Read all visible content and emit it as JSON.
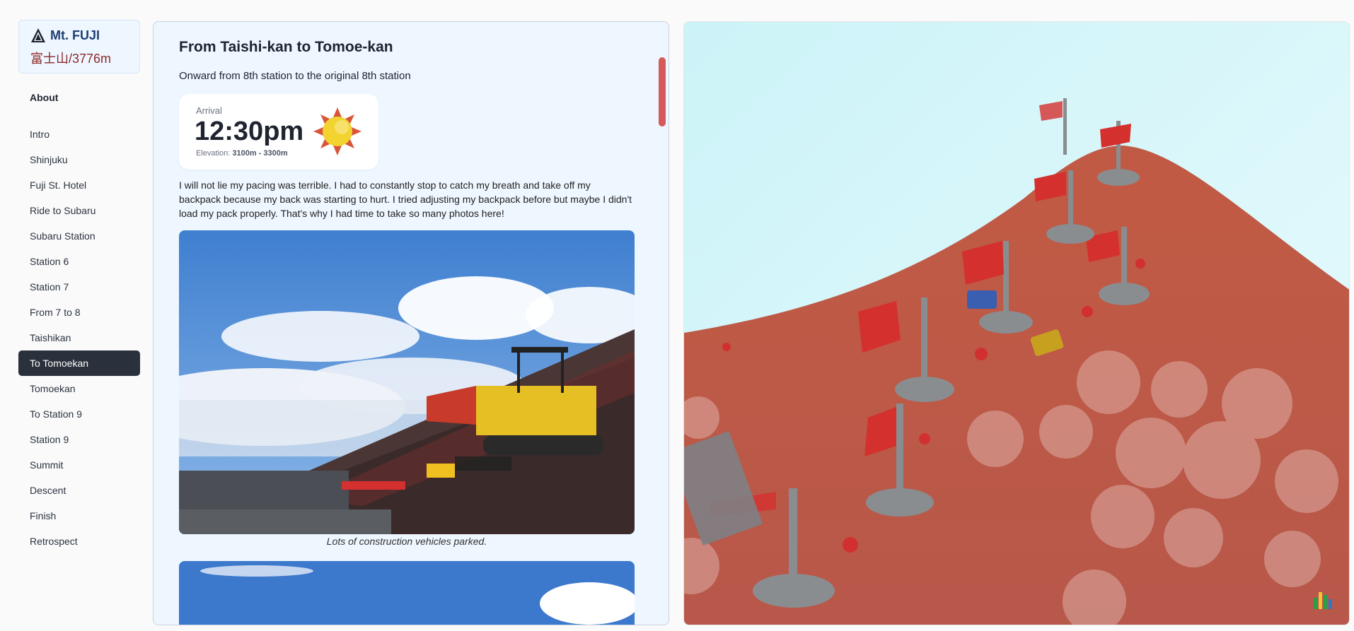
{
  "brand": {
    "title": "Mt. FUJI",
    "subtitle": "富士山/3776m",
    "icon": "mountain-icon"
  },
  "sidebar": {
    "heading": "About",
    "items": [
      {
        "label": "Intro",
        "active": false
      },
      {
        "label": "Shinjuku",
        "active": false
      },
      {
        "label": "Fuji St. Hotel",
        "active": false
      },
      {
        "label": "Ride to Subaru",
        "active": false
      },
      {
        "label": "Subaru Station",
        "active": false
      },
      {
        "label": "Station 6",
        "active": false
      },
      {
        "label": "Station 7",
        "active": false
      },
      {
        "label": "From 7 to 8",
        "active": false
      },
      {
        "label": "Taishikan",
        "active": false
      },
      {
        "label": "To Tomoekan",
        "active": true
      },
      {
        "label": "Tomoekan",
        "active": false
      },
      {
        "label": "To Station 9",
        "active": false
      },
      {
        "label": "Station 9",
        "active": false
      },
      {
        "label": "Summit",
        "active": false
      },
      {
        "label": "Descent",
        "active": false
      },
      {
        "label": "Finish",
        "active": false
      },
      {
        "label": "Retrospect",
        "active": false
      }
    ]
  },
  "article": {
    "title": "From Taishi-kan to Tomoe-kan",
    "subtitle": "Onward from 8th station to the original 8th station",
    "arrival": {
      "label": "Arrival",
      "time": "12:30pm",
      "elevation_label": "Elevation:",
      "elevation_value": "3100m - 3300m",
      "weather_icon": "sun-icon"
    },
    "body": "I will not lie my pacing was terrible.  I had to constantly stop to catch my breath and take off my backpack because my back was starting to hurt.  I tried adjusting my backpack before but maybe I didn't load my pack properly. That's why I had time to take so many photos here!",
    "photo_caption": "Lots of construction vehicles parked."
  },
  "scene": {
    "logo_icon": "app-logo-icon"
  },
  "colors": {
    "accent": "#2a303c",
    "scrollbar": "#d55a5a",
    "brand_bg": "#eef6ff",
    "mountain": "#c0604a"
  }
}
